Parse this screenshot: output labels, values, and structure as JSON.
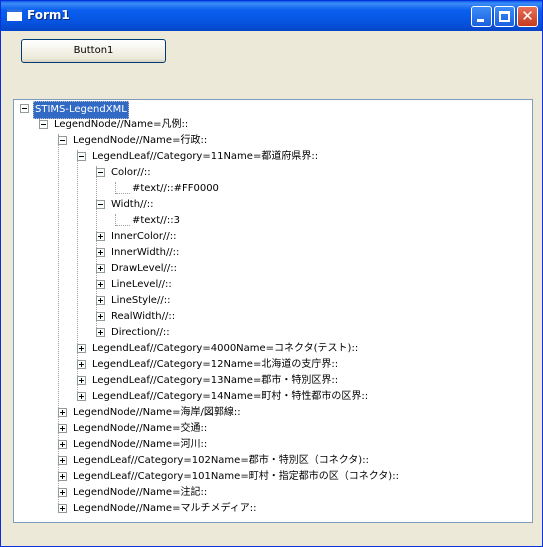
{
  "window": {
    "title": "Form1"
  },
  "button1": {
    "label": "Button1"
  },
  "tree": {
    "root": "STIMS-LegendXML",
    "n1": "LegendNode//Name=凡例::",
    "n2": "LegendNode//Name=行政::",
    "n3": "LegendLeaf//Category=11Name=都道府県界::",
    "n4": "Color//::",
    "n5": "#text//::#FF0000",
    "n6": "Width//::",
    "n7": "#text//::3",
    "n8": "InnerColor//::",
    "n9": "InnerWidth//::",
    "n10": "DrawLevel//::",
    "n11": "LineLevel//::",
    "n12": "LineStyle//::",
    "n13": "RealWidth//::",
    "n14": "Direction//::",
    "n15": "LegendLeaf//Category=4000Name=コネクタ(テスト)::",
    "n16": "LegendLeaf//Category=12Name=北海道の支庁界::",
    "n17": "LegendLeaf//Category=13Name=郡市・特別区界::",
    "n18": "LegendLeaf//Category=14Name=町村・特性都市の区界::",
    "n19": "LegendNode//Name=海岸/図郭線::",
    "n20": "LegendNode//Name=交通::",
    "n21": "LegendNode//Name=河川::",
    "n22": "LegendLeaf//Category=102Name=郡市・特別区（コネクタ)::",
    "n23": "LegendLeaf//Category=101Name=町村・指定都市の区（コネクタ)::",
    "n24": "LegendNode//Name=注記::",
    "n25": "LegendNode//Name=マルチメディア::"
  }
}
